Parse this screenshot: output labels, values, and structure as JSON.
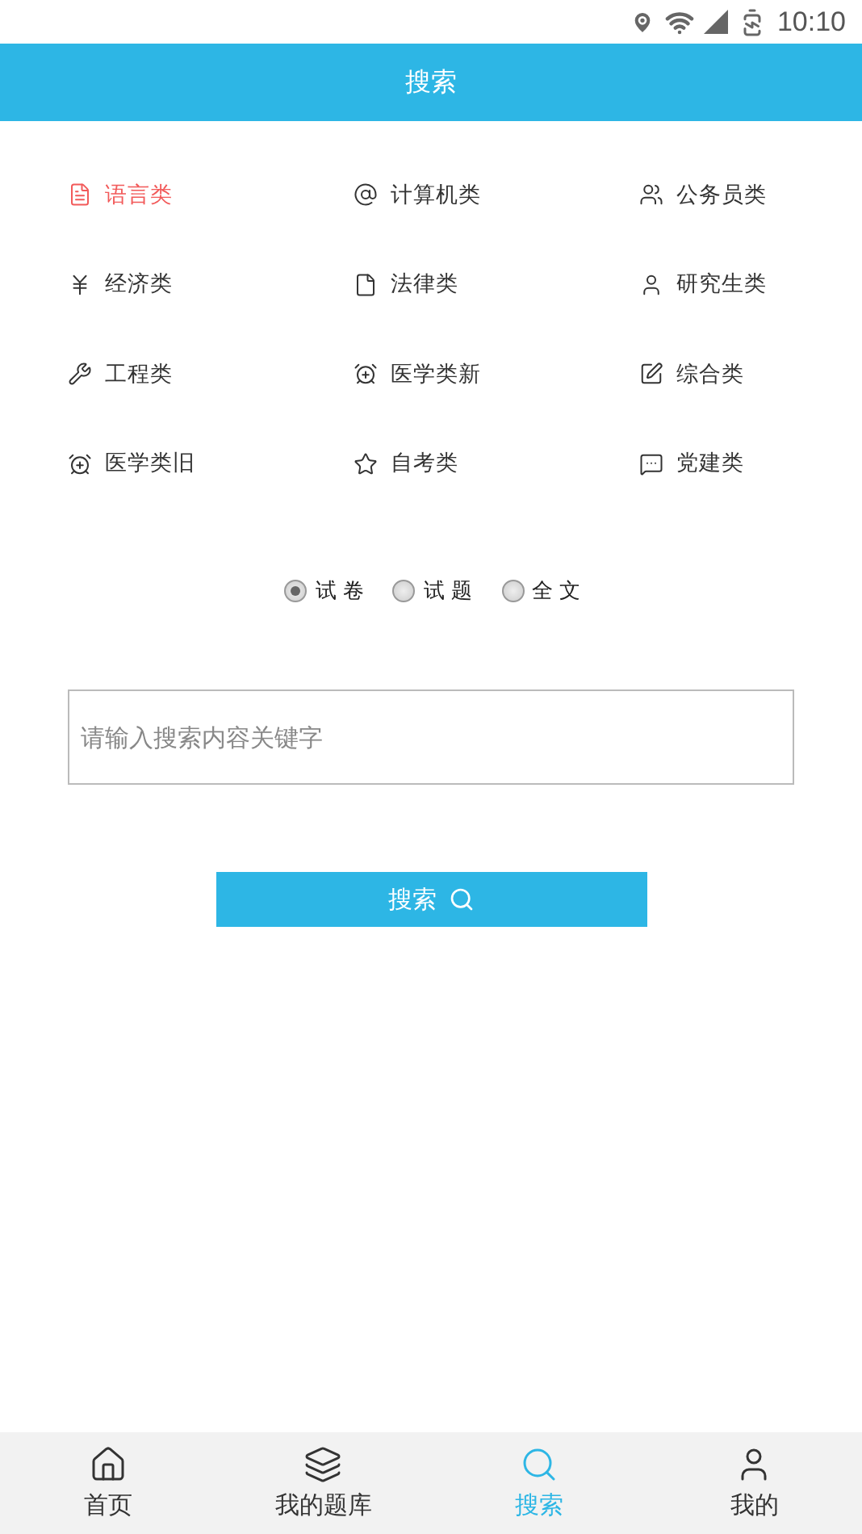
{
  "status_bar": {
    "time": "10:10"
  },
  "header": {
    "title": "搜索"
  },
  "categories": [
    {
      "label": "语言类",
      "selected": true
    },
    {
      "label": "计算机类",
      "selected": false
    },
    {
      "label": "公务员类",
      "selected": false
    },
    {
      "label": "经济类",
      "selected": false
    },
    {
      "label": "法律类",
      "selected": false
    },
    {
      "label": "研究生类",
      "selected": false
    },
    {
      "label": "工程类",
      "selected": false
    },
    {
      "label": "医学类新",
      "selected": false
    },
    {
      "label": "综合类",
      "selected": false
    },
    {
      "label": "医学类旧",
      "selected": false
    },
    {
      "label": "自考类",
      "selected": false
    },
    {
      "label": "党建类",
      "selected": false
    }
  ],
  "search_scope": [
    {
      "label": "试 卷",
      "selected": true
    },
    {
      "label": "试 题",
      "selected": false
    },
    {
      "label": "全 文",
      "selected": false
    }
  ],
  "search_field": {
    "placeholder": "请输入搜索内容关键字"
  },
  "search_button": {
    "label": "搜索"
  },
  "bottom_nav": [
    {
      "label": "首页",
      "selected": false
    },
    {
      "label": "我的题库",
      "selected": false
    },
    {
      "label": "搜索",
      "selected": true
    },
    {
      "label": "我的",
      "selected": false
    }
  ]
}
